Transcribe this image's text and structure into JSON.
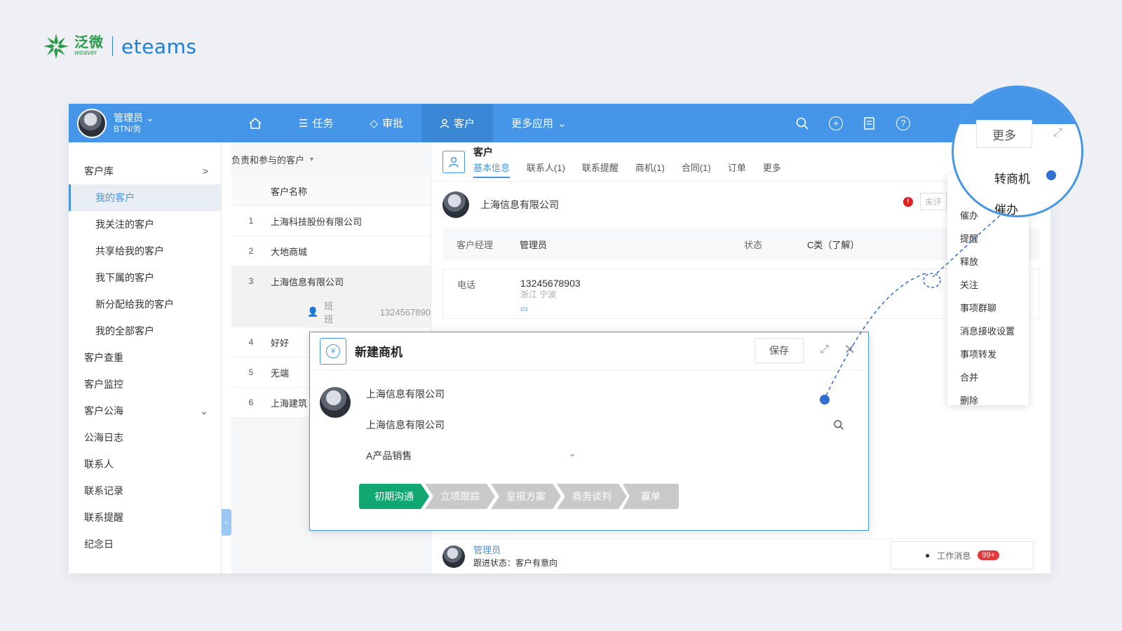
{
  "brand": {
    "cn": "泛微",
    "sub": "weaver",
    "en": "eteams",
    "green": "#2e9a4b",
    "blue": "#1d7ed8"
  },
  "topbar": {
    "user_name": "管理员",
    "user_dept": "BTN/务",
    "nav": [
      {
        "label": "",
        "icon": "home-icon"
      },
      {
        "label": "任务",
        "icon": "list-icon"
      },
      {
        "label": "审批",
        "icon": "stack-icon"
      },
      {
        "label": "客户",
        "icon": "user-icon",
        "active": true
      },
      {
        "label": "更多应用",
        "icon": "chevron-down-icon"
      }
    ],
    "color": "#4596e8"
  },
  "sidebar": {
    "items": [
      {
        "label": "客户库",
        "level": 0,
        "arrow": ">"
      },
      {
        "label": "我的客户",
        "level": 1,
        "active": true
      },
      {
        "label": "我关注的客户",
        "level": 1
      },
      {
        "label": "共享给我的客户",
        "level": 1
      },
      {
        "label": "我下属的客户",
        "level": 1
      },
      {
        "label": "新分配给我的客户",
        "level": 1
      },
      {
        "label": "我的全部客户",
        "level": 1
      },
      {
        "label": "客户查重",
        "level": 0
      },
      {
        "label": "客户监控",
        "level": 0
      },
      {
        "label": "客户公海",
        "level": 0,
        "arrow": "⌄"
      },
      {
        "label": "公海日志",
        "level": 0
      },
      {
        "label": "联系人",
        "level": 0
      },
      {
        "label": "联系记录",
        "level": 0
      },
      {
        "label": "联系提醒",
        "level": 0
      },
      {
        "label": "纪念日",
        "level": 0
      }
    ]
  },
  "list": {
    "filter": "负责和参与的客户",
    "column": "客户名称",
    "rows": [
      {
        "idx": "1",
        "name": "上海科技股份有限公司"
      },
      {
        "idx": "2",
        "name": "大地商城"
      },
      {
        "idx": "3",
        "name": "上海信息有限公司"
      },
      {
        "idx": "4",
        "name": "好好"
      },
      {
        "idx": "5",
        "name": "无端"
      },
      {
        "idx": "6",
        "name": "上海建筑"
      }
    ],
    "sub_contact": "班班",
    "sub_phone": "1324567890"
  },
  "detail": {
    "title": "客户",
    "tabs": [
      "基本信息",
      "联系人(1)",
      "联系提醒",
      "商机(1)",
      "合同(1)",
      "订单",
      "更多"
    ],
    "company": "上海信息有限公司",
    "unrated": "未评",
    "manager_label": "客户经理",
    "manager": "管理员",
    "status_label": "状态",
    "status": "C类（了解）",
    "phone_label": "电话",
    "phone": "13245678903",
    "location": "浙江 宁波",
    "follower": "管理员",
    "follow_status": "跟进状态：客户有意向",
    "work_msg": "工作消息",
    "badge": "99+"
  },
  "dropdown": {
    "items": [
      "催办",
      "提醒",
      "释放",
      "关注",
      "事项群聊",
      "消息接收设置",
      "事项转发",
      "合并",
      "删除"
    ]
  },
  "dialog": {
    "title": "新建商机",
    "save": "保存",
    "company1": "上海信息有限公司",
    "company2": "上海信息有限公司",
    "product": "A产品销售",
    "stages": [
      "初期沟通",
      "立项跟踪",
      "呈报方案",
      "商务谈判",
      "赢单"
    ],
    "stage_active_color": "#11a771"
  },
  "zoom": {
    "more": "更多",
    "item1": "转商机",
    "item2": "催办"
  }
}
